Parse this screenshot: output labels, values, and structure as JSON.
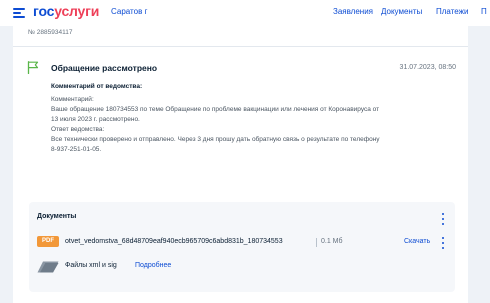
{
  "header": {
    "logo_part1": "гос",
    "logo_part2": "услуги",
    "city": "Саратов г",
    "nav": [
      {
        "label": "Заявления"
      },
      {
        "label": "Документы"
      },
      {
        "label": "Платежи"
      },
      {
        "label": "П"
      }
    ]
  },
  "request": {
    "number": "№ 2885934117",
    "status_title": "Обращение рассмотрено",
    "status_date": "31.07.2023, 08:50",
    "comment_heading": "Комментарий от ведомства:",
    "comment_lines": [
      "Комментарий:",
      "Ваше обращение 180734553 по теме Обращение по проблеме вакцинации или лечения от Коронавируса от",
      "13 июля 2023 г. рассмотрено.",
      "Ответ ведомства:",
      "Все технически проверено и отправлено. Через 3 дня прошу дать обратную связь о результате по телефону",
      "8-937-251-01-05."
    ]
  },
  "documents": {
    "title": "Документы",
    "file": {
      "badge": "PDF",
      "name": "otvet_vedomstva_68d48709eaf940ecb965709c6abd831b_180734553",
      "size": "0.1 Мб",
      "download_label": "Скачать"
    },
    "xml_label": "Файлы xml и sig",
    "more_label": "Подробнее"
  },
  "colors": {
    "brand_blue": "#0d4cd3",
    "brand_red": "#ee3f58",
    "status_green": "#5ab649",
    "pdf_orange": "#f29839",
    "page_bg": "#eef2f7"
  },
  "icons": {
    "menu": "hamburger-menu-icon",
    "status": "flag-icon",
    "more": "kebab-menu-icon",
    "xml": "signature-file-icon"
  }
}
